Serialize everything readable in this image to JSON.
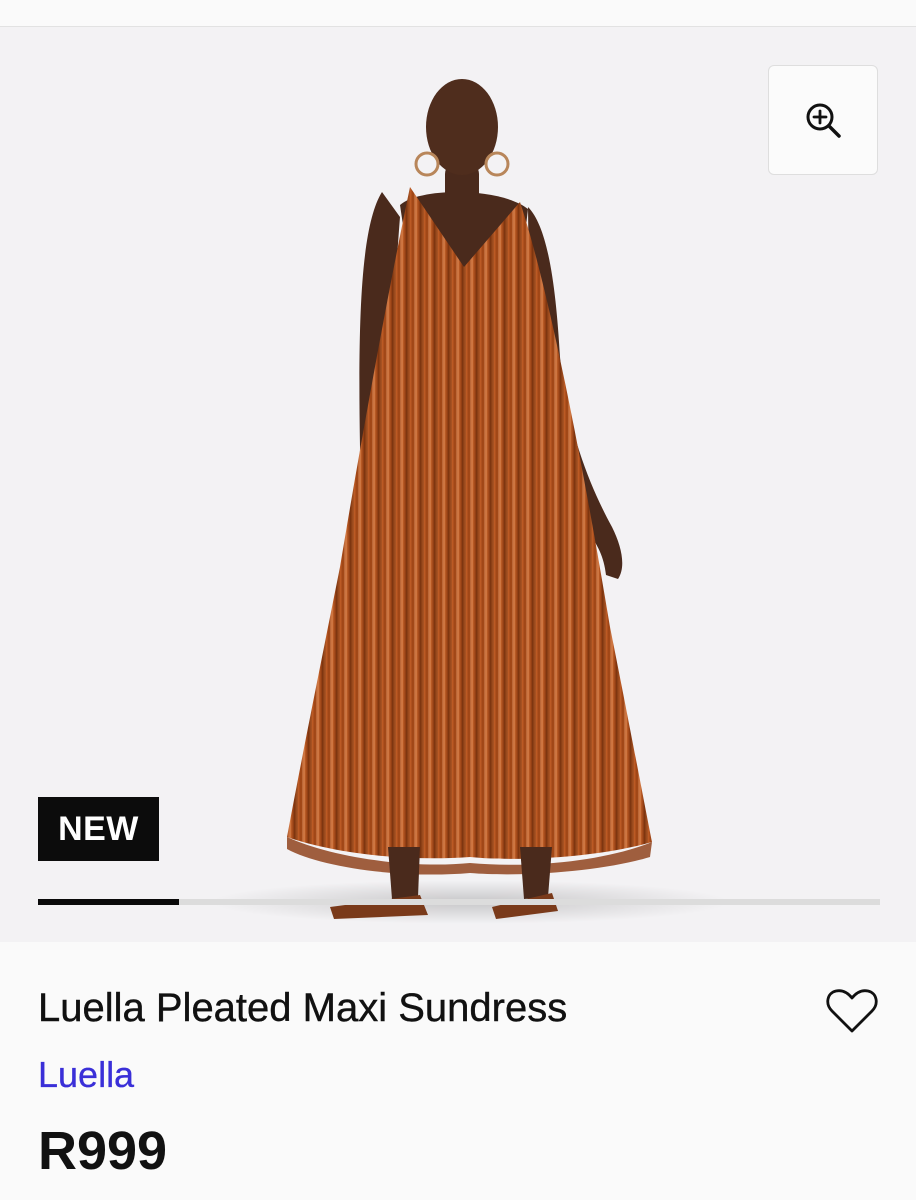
{
  "gallery": {
    "image_alt": "Model wearing rust orange pleated satin maxi sundress",
    "badge": "NEW",
    "slide_progress": 0.167,
    "zoom_icon": "zoom-in-icon"
  },
  "product": {
    "title": "Luella Pleated Maxi Sundress",
    "brand": "Luella",
    "price": "R999",
    "wishlist_icon": "heart-outline-icon"
  },
  "colors": {
    "brand_link": "#3a2fd8",
    "dress": "#b5541c",
    "badge_bg": "#0c0c0c"
  }
}
